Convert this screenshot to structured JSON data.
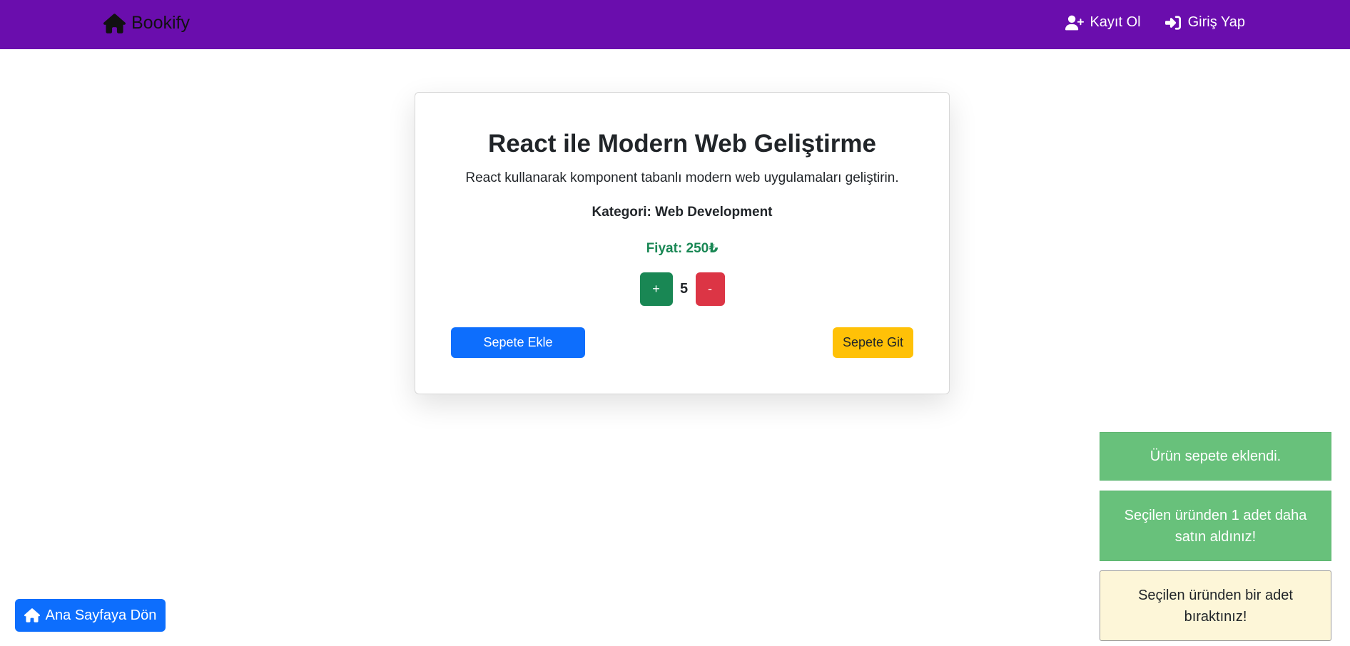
{
  "navbar": {
    "brand": "Bookify",
    "brand_icon": "home-icon",
    "register_label": "Kayıt Ol",
    "register_icon": "user-plus-icon",
    "login_label": "Giriş Yap",
    "login_icon": "sign-in-icon",
    "background_color": "#6a0dad"
  },
  "product": {
    "title": "React ile Modern Web Geliştirme",
    "description": "React kullanarak komponent tabanlı modern web uygulamaları geliştirin.",
    "category": "Kategori: Web Development",
    "price": "Fiyat: 250₺",
    "plus_label": "+",
    "quantity": "5",
    "minus_label": "-",
    "add_to_cart_label": "Sepete Ekle",
    "go_to_cart_label": "Sepete Git"
  },
  "toasts": [
    {
      "text": "Ürün sepete eklendi.",
      "type": "success"
    },
    {
      "text": "Seçilen üründen 1 adet daha satın aldınız!",
      "type": "success"
    },
    {
      "text": "Seçilen üründen bir adet bıraktınız!",
      "type": "warning"
    }
  ],
  "home_button": {
    "label": "Ana Sayfaya Dön",
    "icon": "home-icon"
  },
  "colors": {
    "primary": "#0d6efd",
    "success": "#198754",
    "danger": "#dc3545",
    "warning": "#ffc107"
  }
}
